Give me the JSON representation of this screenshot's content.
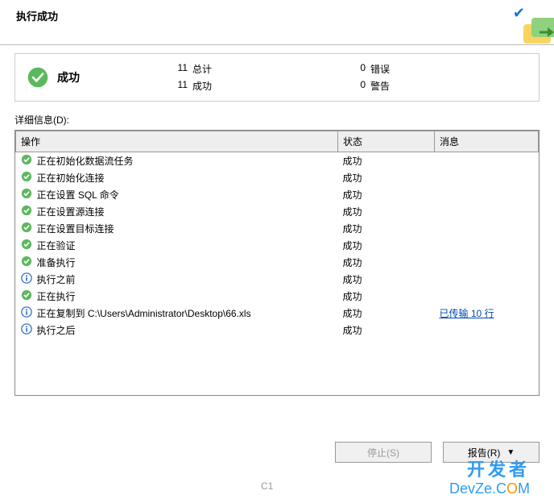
{
  "header": {
    "title": "执行成功"
  },
  "summary": {
    "title": "成功",
    "stats": {
      "total_num": "11",
      "total_label": "总计",
      "success_num": "11",
      "success_label": "成功",
      "error_num": "0",
      "error_label": "错误",
      "warning_num": "0",
      "warning_label": "警告"
    }
  },
  "details_label": "详细信息(D):",
  "columns": {
    "op": "操作",
    "status": "状态",
    "msg": "消息"
  },
  "rows": [
    {
      "icon": "success",
      "op": "正在初始化数据流任务",
      "status": "成功",
      "msg": ""
    },
    {
      "icon": "success",
      "op": "正在初始化连接",
      "status": "成功",
      "msg": ""
    },
    {
      "icon": "success",
      "op": "正在设置 SQL 命令",
      "status": "成功",
      "msg": ""
    },
    {
      "icon": "success",
      "op": "正在设置源连接",
      "status": "成功",
      "msg": ""
    },
    {
      "icon": "success",
      "op": "正在设置目标连接",
      "status": "成功",
      "msg": ""
    },
    {
      "icon": "success",
      "op": "正在验证",
      "status": "成功",
      "msg": ""
    },
    {
      "icon": "success",
      "op": "准备执行",
      "status": "成功",
      "msg": ""
    },
    {
      "icon": "info",
      "op": "执行之前",
      "status": "成功",
      "msg": ""
    },
    {
      "icon": "success",
      "op": "正在执行",
      "status": "成功",
      "msg": ""
    },
    {
      "icon": "info",
      "op": "正在复制到 C:\\Users\\Administrator\\Desktop\\66.xls",
      "status": "成功",
      "msg": "已传输 10 行",
      "link": true
    },
    {
      "icon": "info",
      "op": "执行之后",
      "status": "成功",
      "msg": ""
    }
  ],
  "buttons": {
    "stop": "停止(S)",
    "report": "报告(R)"
  },
  "watermark": {
    "line1": "开发者",
    "line2a": "DevZe.C",
    "line2b": "O",
    "line2c": "M"
  },
  "footer": "C1"
}
